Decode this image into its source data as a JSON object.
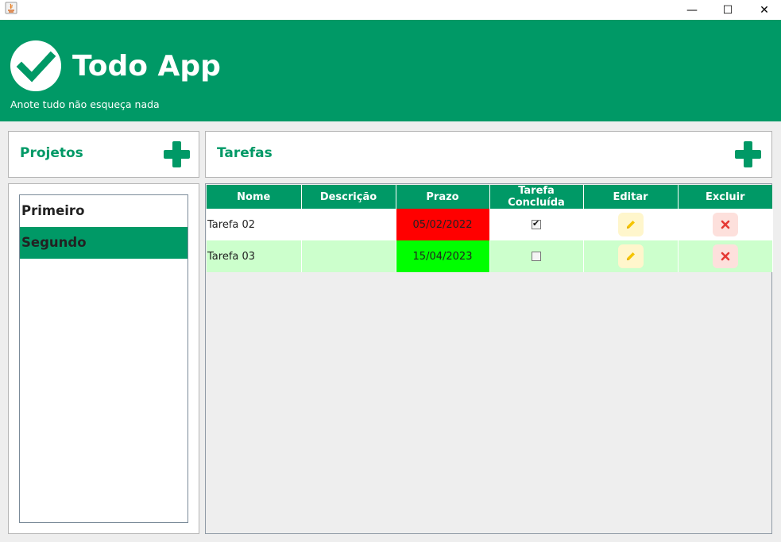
{
  "window": {
    "minimize_glyph": "—",
    "maximize_glyph": "☐",
    "close_glyph": "✕"
  },
  "header": {
    "title": "Todo App",
    "subtitle": "Anote tudo não esqueça nada",
    "logo_icon": "check-circle-icon",
    "bg_color": "#009966"
  },
  "projects": {
    "title": "Projetos",
    "add_icon": "plus-icon",
    "items": [
      {
        "label": "Primeiro",
        "selected": false
      },
      {
        "label": "Segundo",
        "selected": true
      }
    ]
  },
  "tasks": {
    "title": "Tarefas",
    "add_icon": "plus-icon",
    "columns": [
      "Nome",
      "Descrição",
      "Prazo",
      "Tarefa Concluída",
      "Editar",
      "Excluir"
    ],
    "rows": [
      {
        "name": "Tarefa 02",
        "description": "",
        "deadline": "05/02/2022",
        "deadline_status": "late",
        "completed": true
      },
      {
        "name": "Tarefa 03",
        "description": "",
        "deadline": "15/04/2023",
        "deadline_status": "on-time",
        "completed": false
      }
    ]
  },
  "colors": {
    "accent": "#009966",
    "late": "#ff0000",
    "on_time": "#00ff00",
    "alt_row": "#ccffcc",
    "edit_icon": "#f5c400",
    "delete_icon": "#e53935"
  }
}
